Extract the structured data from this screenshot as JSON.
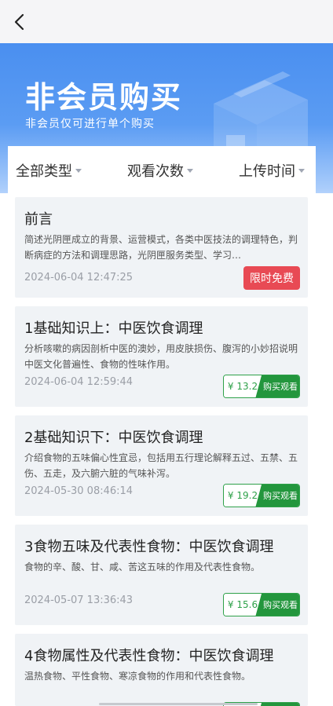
{
  "header": {
    "back_icon": "chevron-left-icon"
  },
  "hero": {
    "title": "非会员购买",
    "subtitle": "非会员仅可进行单个购买",
    "accent": "#4a8ff0"
  },
  "filters": [
    {
      "label": "全部类型"
    },
    {
      "label": "观看次数"
    },
    {
      "label": "上传时间"
    }
  ],
  "colors": {
    "free": "#e84a54",
    "buy": "#23963d",
    "card_bg": "#f0f3f6"
  },
  "cards": [
    {
      "title": "前言",
      "desc": "简述光阴匣成立的背景、运营模式，各类中医技法的调理特色，判断病症的方法和调理思路，光阴匣服务类型、学习…",
      "date": "2024-06-04 12:47:25",
      "badge": "限时免费"
    },
    {
      "title": "1基础知识上：中医饮食调理",
      "desc": "分析咳嗽的病因剖析中医的澳妙，用皮肤损伤、腹泻的小妙招说明中医文化普遍性、食物的性味作用。",
      "date": "2024-06-04 12:59:44",
      "price": "¥ 13.2",
      "action": "购买观看"
    },
    {
      "title": "2基础知识下：中医饮食调理",
      "desc": "介绍食物的五味偏心性宜忌，包括用五行理论解释五过、五禁、五伤、五走，及六腑六脏的气味补泻。",
      "date": "2024-05-30 08:46:14",
      "price": "¥ 19.2",
      "action": "购买观看"
    },
    {
      "title": "3食物五味及代表性食物：中医饮食调理",
      "desc": "食物的辛、酸、甘、咸、苦这五味的作用及代表性食物。",
      "date": "2024-05-07 13:36:43",
      "price": "¥ 15.6",
      "action": "购买观看"
    },
    {
      "title": "4食物属性及代表性食物：中医饮食调理",
      "desc": "温热食物、平性食物、寒凉食物的作用和代表性食物。"
    }
  ]
}
